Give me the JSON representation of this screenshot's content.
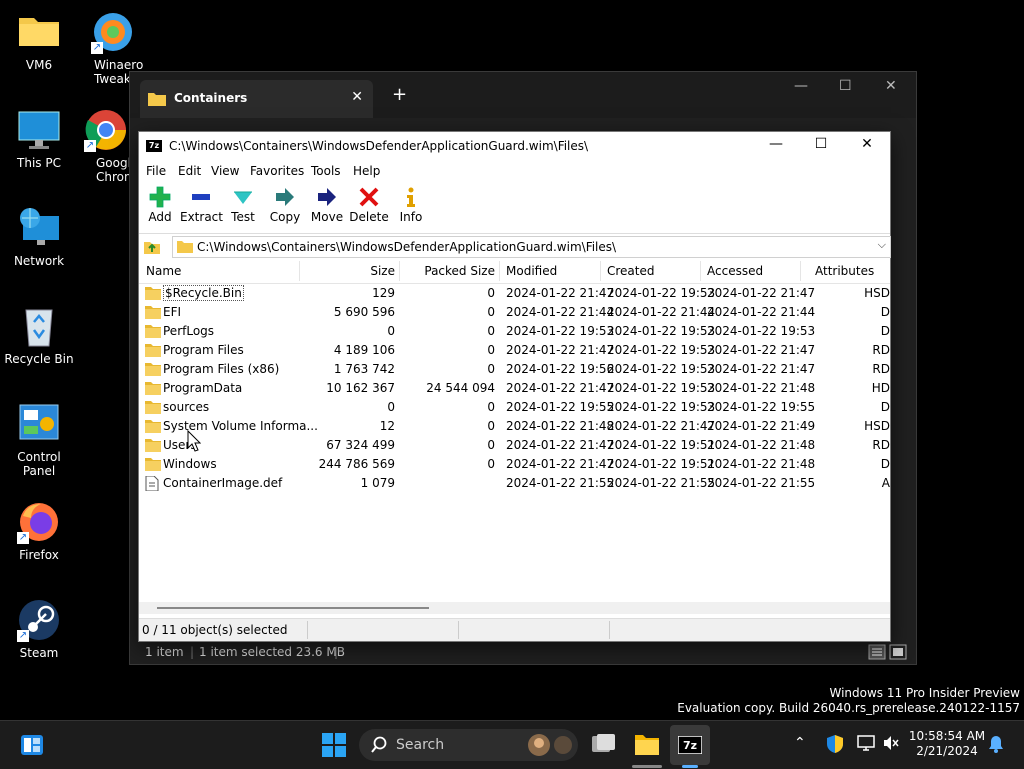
{
  "desktop": {
    "icons": [
      {
        "label": "VM6"
      },
      {
        "label": "Winaero Tweak..."
      },
      {
        "label": "This PC"
      },
      {
        "label": "Google Chrome"
      },
      {
        "label": "Network"
      },
      {
        "label": "Recycle Bin"
      },
      {
        "label": "Control Panel"
      },
      {
        "label": "Firefox"
      },
      {
        "label": "Steam"
      }
    ]
  },
  "explorer": {
    "tab_title": "Containers",
    "status": {
      "items": "1 item",
      "selected": "1 item selected  23.6 MB"
    }
  },
  "sevenzip": {
    "title": "C:\\Windows\\Containers\\WindowsDefenderApplicationGuard.wim\\Files\\",
    "menu": [
      "File",
      "Edit",
      "View",
      "Favorites",
      "Tools",
      "Help"
    ],
    "toolbar": [
      "Add",
      "Extract",
      "Test",
      "Copy",
      "Move",
      "Delete",
      "Info"
    ],
    "address": "C:\\Windows\\Containers\\WindowsDefenderApplicationGuard.wim\\Files\\",
    "columns": [
      "Name",
      "Size",
      "Packed Size",
      "Modified",
      "Created",
      "Accessed",
      "Attributes"
    ],
    "rows": [
      {
        "type": "folder",
        "name": "$Recycle.Bin",
        "size": "129",
        "packed": "0",
        "modified": "2024-01-22 21:47",
        "created": "2024-01-22 19:53",
        "accessed": "2024-01-22 21:47",
        "attr": "HSD"
      },
      {
        "type": "folder",
        "name": "EFI",
        "size": "5 690 596",
        "packed": "0",
        "modified": "2024-01-22 21:44",
        "created": "2024-01-22 21:44",
        "accessed": "2024-01-22 21:44",
        "attr": "D"
      },
      {
        "type": "folder",
        "name": "PerfLogs",
        "size": "0",
        "packed": "0",
        "modified": "2024-01-22 19:53",
        "created": "2024-01-22 19:53",
        "accessed": "2024-01-22 19:53",
        "attr": "D"
      },
      {
        "type": "folder",
        "name": "Program Files",
        "size": "4 189 106",
        "packed": "0",
        "modified": "2024-01-22 21:47",
        "created": "2024-01-22 19:53",
        "accessed": "2024-01-22 21:47",
        "attr": "RD"
      },
      {
        "type": "folder",
        "name": "Program Files (x86)",
        "size": "1 763 742",
        "packed": "0",
        "modified": "2024-01-22 19:56",
        "created": "2024-01-22 19:53",
        "accessed": "2024-01-22 21:47",
        "attr": "RD"
      },
      {
        "type": "folder",
        "name": "ProgramData",
        "size": "10 162 367",
        "packed": "24 544 094",
        "modified": "2024-01-22 21:47",
        "created": "2024-01-22 19:53",
        "accessed": "2024-01-22 21:48",
        "attr": "HD"
      },
      {
        "type": "folder",
        "name": "sources",
        "size": "0",
        "packed": "0",
        "modified": "2024-01-22 19:55",
        "created": "2024-01-22 19:53",
        "accessed": "2024-01-22 19:55",
        "attr": "D"
      },
      {
        "type": "folder",
        "name": "System Volume Informa...",
        "size": "12",
        "packed": "0",
        "modified": "2024-01-22 21:48",
        "created": "2024-01-22 21:47",
        "accessed": "2024-01-22 21:49",
        "attr": "HSD"
      },
      {
        "type": "folder",
        "name": "Users",
        "size": "67 324 499",
        "packed": "0",
        "modified": "2024-01-22 21:47",
        "created": "2024-01-22 19:51",
        "accessed": "2024-01-22 21:48",
        "attr": "RD"
      },
      {
        "type": "folder",
        "name": "Windows",
        "size": "244 786 569",
        "packed": "0",
        "modified": "2024-01-22 21:47",
        "created": "2024-01-22 19:51",
        "accessed": "2024-01-22 21:48",
        "attr": "D"
      },
      {
        "type": "file",
        "name": "ContainerImage.def",
        "size": "1 079",
        "packed": "",
        "modified": "2024-01-22 21:55",
        "created": "2024-01-22 21:55",
        "accessed": "2024-01-22 21:55",
        "attr": "A"
      }
    ],
    "status": "0 / 11 object(s) selected"
  },
  "watermark": {
    "line1": "Windows 11 Pro Insider Preview",
    "line2": "Evaluation copy. Build 26040.rs_prerelease.240122-1157"
  },
  "taskbar": {
    "search_label": "Search",
    "time": "10:58:54 AM",
    "date": "2/21/2024"
  }
}
